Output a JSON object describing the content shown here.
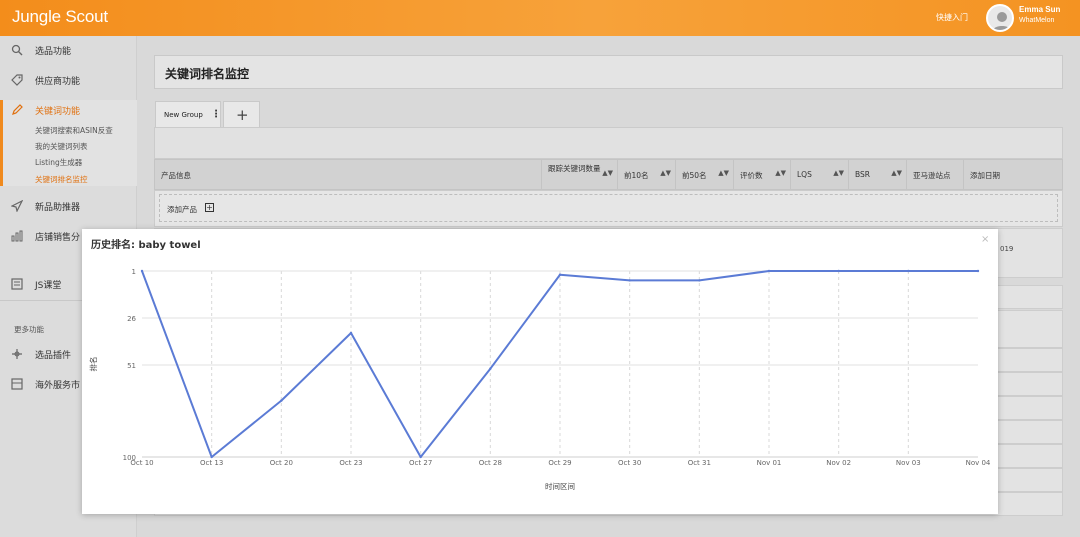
{
  "header": {
    "logo": "Jungle Scout",
    "quick_entry": "快捷入门",
    "user_name": "Emma Sun",
    "user_company": "WhatMelon"
  },
  "sidebar": {
    "items": [
      {
        "label": "选品功能",
        "icon": "search-icon"
      },
      {
        "label": "供应商功能",
        "icon": "tag-icon"
      },
      {
        "label": "关键词功能",
        "icon": "pencil-icon",
        "active": true
      },
      {
        "label": "新品助推器",
        "icon": "rocket-icon"
      },
      {
        "label": "店铺销售分",
        "icon": "bar-chart-icon"
      },
      {
        "label": "JS课堂",
        "icon": "book-icon"
      },
      {
        "label": "选品插件",
        "icon": "puzzle-icon"
      },
      {
        "label": "海外服务市",
        "icon": "store-icon"
      }
    ],
    "sub_items": [
      {
        "label": "关键词搜索和ASIN反查"
      },
      {
        "label": "我的关键词列表"
      },
      {
        "label": "Listing生成器"
      },
      {
        "label": "关键词排名监控",
        "active": true
      }
    ],
    "more_label": "更多功能"
  },
  "page": {
    "title": "关键词排名监控",
    "tabs": [
      {
        "label": "New Group"
      }
    ],
    "add_tab_label": "+",
    "table_headers": [
      "产品信息",
      "跟踪关键词数量",
      "前10名",
      "前50名",
      "评价数",
      "LQS",
      "BSR",
      "亚马逊站点",
      "添加日期"
    ],
    "add_product_label": "添加产品",
    "year_fragment": "019"
  },
  "modal": {
    "title": "历史排名: baby towel",
    "close": "×",
    "accent": "#5b7bd5"
  },
  "chart_data": {
    "type": "line",
    "title": "历史排名: baby towel",
    "xlabel": "时间区间",
    "ylabel": "排名",
    "y_inverted": true,
    "ylim": [
      1,
      100
    ],
    "yticks": [
      1,
      26,
      51,
      100
    ],
    "categories": [
      "Oct 10",
      "Oct 13",
      "Oct 20",
      "Oct 23",
      "Oct 27",
      "Oct 28",
      "Oct 29",
      "Oct 30",
      "Oct 31",
      "Nov 01",
      "Nov 02",
      "Nov 03",
      "Nov 04"
    ],
    "series": [
      {
        "values": [
          1,
          100,
          70,
          34,
          100,
          53,
          3,
          6,
          6,
          1,
          1,
          1,
          1
        ]
      }
    ],
    "grid": true
  }
}
